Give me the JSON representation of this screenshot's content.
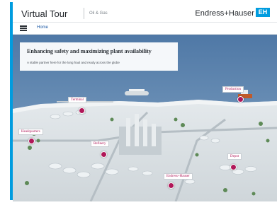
{
  "header": {
    "title": "Virtual Tour",
    "subtitle": "Oil & Gas",
    "brand": "Endress+Hauser",
    "logo_text": "EH"
  },
  "nav": {
    "menu_icon": "hamburger-menu-icon",
    "home_label": "Home"
  },
  "banner": {
    "title": "Enhancing safety and maximizing plant availability",
    "subtitle": "A stable partner here for the long haul and ready across the globe"
  },
  "locations": [
    {
      "label": "Terminal"
    },
    {
      "label": "Production"
    },
    {
      "label": "Headquarters"
    },
    {
      "label": "Refinery"
    },
    {
      "label": "Depot"
    },
    {
      "label": "Endress+Hauser"
    }
  ],
  "colors": {
    "accent": "#009cdf",
    "pin": "#b01758",
    "sea": "#5f84ad",
    "land": "#dde3e6"
  }
}
